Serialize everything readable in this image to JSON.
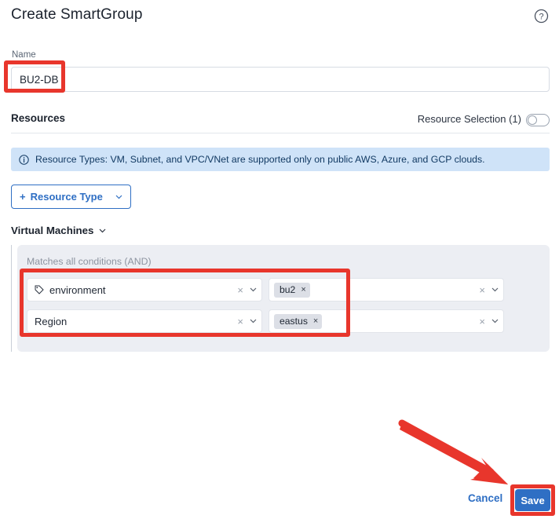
{
  "header": {
    "title": "Create SmartGroup",
    "help_icon": "help-circle-icon"
  },
  "name_field": {
    "label": "Name",
    "value": "BU2-DB",
    "placeholder": ""
  },
  "resources": {
    "section_title": "Resources",
    "resource_selection_label": "Resource Selection (1)",
    "toggle_state": "off",
    "info_banner": {
      "icon": "info-circle-icon",
      "text": "Resource Types: VM, Subnet, and VPC/VNet are supported only on public AWS, Azure, and GCP clouds."
    },
    "add_button": {
      "plus": "+",
      "label": "Resource Type",
      "caret": "chevron-down-icon"
    }
  },
  "virtual_machines": {
    "title": "Virtual Machines",
    "caret": "chevron-down-icon",
    "conditions_label": "Matches all conditions (AND)",
    "rows": [
      {
        "key": "environment",
        "key_icon": "tag-icon",
        "key_clear": "×",
        "key_caret": "chevron-down-icon",
        "values": [
          {
            "label": "bu2",
            "remove": "×"
          }
        ],
        "value_clear": "×",
        "value_caret": "chevron-down-icon"
      },
      {
        "key": "Region",
        "key_icon": "",
        "key_clear": "×",
        "key_caret": "chevron-down-icon",
        "values": [
          {
            "label": "eastus",
            "remove": "×"
          }
        ],
        "value_clear": "×",
        "value_caret": "chevron-down-icon"
      }
    ]
  },
  "footer": {
    "cancel_label": "Cancel",
    "save_label": "Save"
  },
  "annotations": {
    "highlight_color": "#e8362c",
    "arrow": "arrow-pointing-to-save-button"
  },
  "colors": {
    "accent_blue": "#2f6fc4",
    "banner_blue": "#cfe3f8",
    "panel_gray": "#eceef3",
    "chip_gray": "#dcdfe6",
    "highlight_red": "#e8362c"
  }
}
